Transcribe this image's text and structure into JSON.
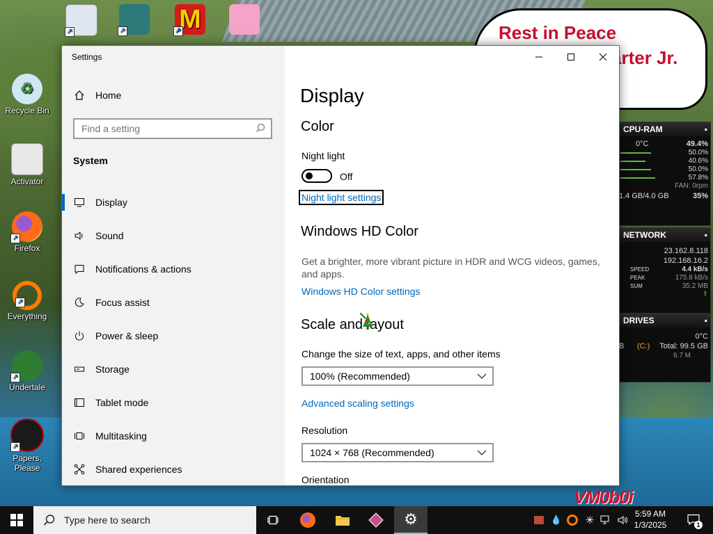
{
  "desktop": {
    "icons": [
      {
        "label": "Recycle Bin"
      },
      {
        "label": "Activator"
      },
      {
        "label": "Firefox"
      },
      {
        "label": "Everything"
      },
      {
        "label": "Undertale"
      },
      {
        "label": "Papers, Please"
      }
    ],
    "wallpaper_text": {
      "line1": "Rest in Peace",
      "line2": "arter Jr.",
      "corner": "VM0b0i"
    }
  },
  "window": {
    "app_title": "Settings",
    "controls": {
      "minimize": "—",
      "maximize": "☐",
      "close": "✕"
    }
  },
  "sidebar": {
    "home_label": "Home",
    "search_placeholder": "Find a setting",
    "section_label": "System",
    "items": [
      {
        "label": "Display",
        "icon": "monitor-icon",
        "active": true
      },
      {
        "label": "Sound",
        "icon": "speaker-icon"
      },
      {
        "label": "Notifications & actions",
        "icon": "notification-icon"
      },
      {
        "label": "Focus assist",
        "icon": "moon-icon"
      },
      {
        "label": "Power & sleep",
        "icon": "power-icon"
      },
      {
        "label": "Storage",
        "icon": "storage-icon"
      },
      {
        "label": "Tablet mode",
        "icon": "tablet-icon"
      },
      {
        "label": "Multitasking",
        "icon": "multitasking-icon"
      },
      {
        "label": "Shared experiences",
        "icon": "shared-icon"
      }
    ]
  },
  "content": {
    "page_title": "Display",
    "color_heading": "Color",
    "night_light_label": "Night light",
    "night_light_state": "Off",
    "night_light_settings_link": "Night light settings",
    "hdr_heading": "Windows HD Color",
    "hdr_description": "Get a brighter, more vibrant picture in HDR and WCG videos, games, and apps.",
    "hdr_settings_link": "Windows HD Color settings",
    "scale_heading": "Scale and layout",
    "scale_label": "Change the size of text, apps, and other items",
    "scale_value": "100% (Recommended)",
    "advanced_scaling_link": "Advanced scaling settings",
    "resolution_label": "Resolution",
    "resolution_value": "1024 × 768 (Recommended)",
    "orientation_label": "Orientation"
  },
  "gadget": {
    "cpu": {
      "title": "CPU-RAM",
      "temp": "0°C",
      "total": "49.4%",
      "cores": [
        "50.0%",
        "40.6%",
        "50.0%",
        "57.8%"
      ],
      "fan": "FAN: 0rpm",
      "ram": "1.4 GB/4.0 GB",
      "ram_pct": "35%"
    },
    "network": {
      "title": "NETWORK",
      "ip1": "23.162.8.118",
      "ip2": "192.168.16.2",
      "speed_label": "SPEED",
      "speed": "4.4 kB/s",
      "peak_label": "PEAK",
      "peak": "175.8 kB/s",
      "sum_label": "SUM",
      "sum": "35.2 MB"
    },
    "drives": {
      "title": "DRIVES",
      "temp": "0°C",
      "drive": "(C:)",
      "total": "Total: 99.5 GB",
      "used": "6.7 M",
      "left": "B"
    }
  },
  "taskbar": {
    "search_placeholder": "Type here to search",
    "time": "5:59 AM",
    "date": "1/3/2025",
    "notification_count": "1"
  },
  "colors": {
    "accent": "#0067c0",
    "link": "#0067b8",
    "sidebar_bg": "#f2f2f2",
    "taskbar_bg": "#101010",
    "gadget_green": "#5bbf3a",
    "bubble_red": "#c8102e"
  }
}
